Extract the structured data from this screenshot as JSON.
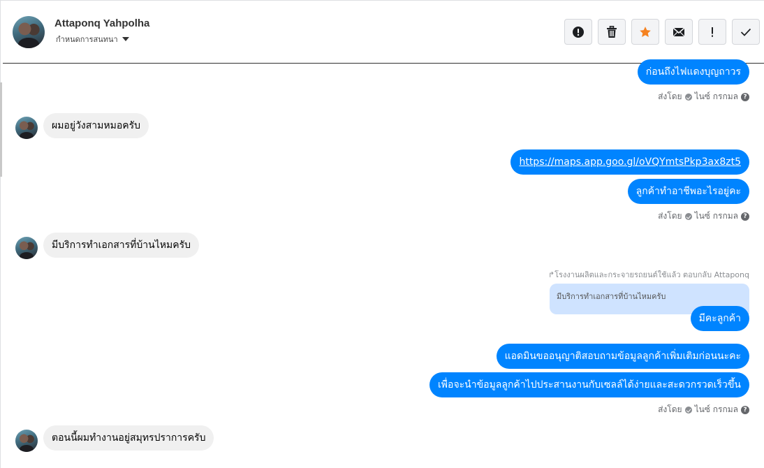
{
  "header": {
    "name": "Attaponq Yahpolha",
    "subtitle": "กำหนดการสนทนา"
  },
  "toolbar": [
    {
      "icon": "alert-circle-icon"
    },
    {
      "icon": "trash-icon"
    },
    {
      "icon": "star-icon",
      "color": "#f58220"
    },
    {
      "icon": "envelope-icon"
    },
    {
      "icon": "exclamation-icon",
      "label": "!"
    },
    {
      "icon": "checkmark-icon"
    }
  ],
  "messages": {
    "m1": "ก่อนถึงไฟแดงบุญถาวร",
    "meta1": {
      "sent_by": "ส่งโดย",
      "sender": "ไนซ์ กรกมล"
    },
    "m2": "ผมอยู่วังสามหมอครับ",
    "m3": "https://maps.app.goo.gl/oVQYmtsPkp3ax8zt5",
    "m4": "ลูกค้าทำอาชีพอะไรอยู่คะ",
    "meta2": {
      "sent_by": "ส่งโดย",
      "sender": "ไนซ์ กรกมล"
    },
    "m5": "มีบริการทำเอกสารที่บ้านไหมครับ",
    "reply_note": "โรงงานผลิตและกระจายรถยนต์ใช้แล้ว ตอบกลับ Attaponq",
    "quoted": "มีบริการทำเอกสารที่บ้านไหมครับ",
    "m6": "มีคะลูกค้า",
    "m7": "แอดมินขออนุญาติสอบถามข้อมูลลูกค้าเพิ่มเติมก่อนนะคะ",
    "m8": "เพื่อจะนำข้อมูลลูกค้าไปประสานงานกับเซลล์ได้ง่ายและสะดวกรวดเร็วขึ้น",
    "meta3": {
      "sent_by": "ส่งโดย",
      "sender": "ไนซ์ กรกมล"
    },
    "m9": "ตอนนี้ผมทำงานอยู่สมุทรปราการครับ"
  },
  "colors": {
    "outgoing": "#0084ff",
    "incoming": "#f0f0f0",
    "quoted": "#cfe3ff"
  }
}
